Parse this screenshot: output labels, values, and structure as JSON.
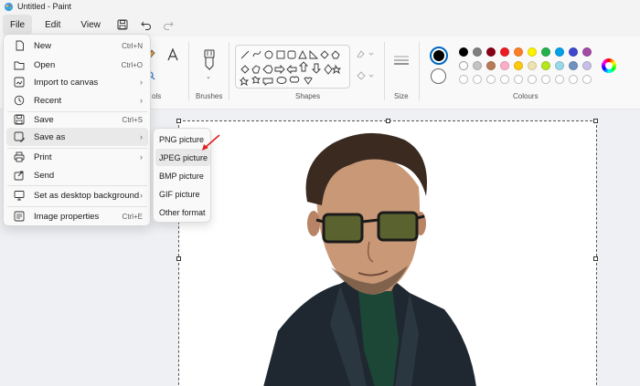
{
  "window": {
    "title": "Untitled - Paint"
  },
  "menubar": {
    "file": "File",
    "edit": "Edit",
    "view": "View"
  },
  "ribbon": {
    "groups": {
      "tools": "ols",
      "brushes": "Brushes",
      "shapes": "Shapes",
      "size": "Size",
      "colours": "Colours"
    },
    "accent_color": "#0067c0"
  },
  "file_menu": {
    "items": [
      {
        "label": "New",
        "shortcut": "Ctrl+N",
        "icon": "new-file-icon"
      },
      {
        "label": "Open",
        "shortcut": "Ctrl+O",
        "icon": "folder-icon"
      },
      {
        "label": "Import to canvas",
        "shortcut": "",
        "icon": "import-icon",
        "submenu": true
      },
      {
        "label": "Recent",
        "shortcut": "",
        "icon": "clock-icon",
        "submenu": true
      },
      {
        "label": "Save",
        "shortcut": "Ctrl+S",
        "icon": "save-icon"
      },
      {
        "label": "Save as",
        "shortcut": "",
        "icon": "save-as-icon",
        "submenu": true
      },
      {
        "label": "Print",
        "shortcut": "",
        "icon": "printer-icon",
        "submenu": true
      },
      {
        "label": "Send",
        "shortcut": "",
        "icon": "share-icon"
      },
      {
        "label": "Set as desktop background",
        "shortcut": "",
        "icon": "desktop-icon",
        "submenu": true
      },
      {
        "label": "Image properties",
        "shortcut": "Ctrl+E",
        "icon": "image-properties-icon"
      }
    ]
  },
  "save_as_submenu": {
    "items": [
      "PNG picture",
      "JPEG picture",
      "BMP picture",
      "GIF picture",
      "Other format"
    ]
  },
  "palette": {
    "primary": "#000000",
    "secondary": "#ffffff",
    "row1": [
      "#000000",
      "#7f7f7f",
      "#880015",
      "#ed1c24",
      "#ff7f27",
      "#fff200",
      "#22b14c",
      "#00a2e8",
      "#3f48cc",
      "#a349a4"
    ],
    "row2": [
      "#ffffff",
      "#c3c3c3",
      "#b97a57",
      "#ffaec9",
      "#ffc90e",
      "#efe4b0",
      "#b5e61d",
      "#99d9ea",
      "#7092be",
      "#c8bfe7"
    ]
  }
}
